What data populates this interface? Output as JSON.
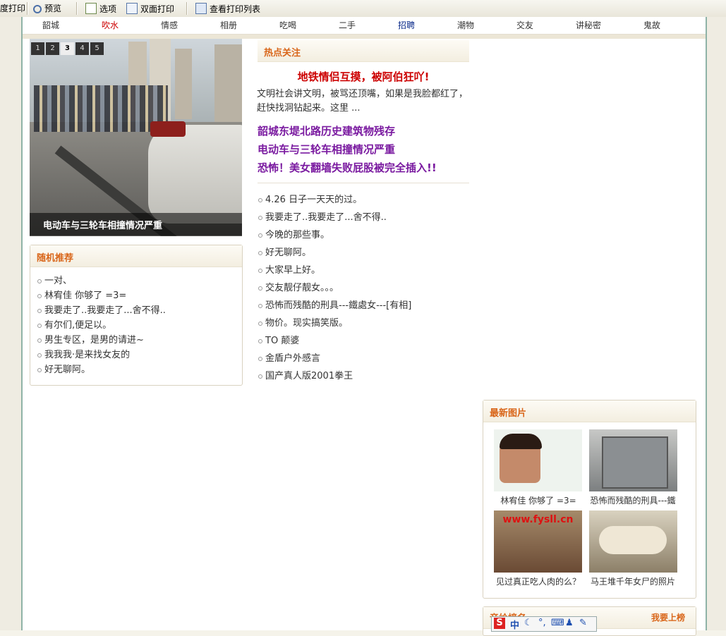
{
  "toolbar": {
    "print": "度打印",
    "preview": "预览",
    "options": "选项",
    "duplex": "双面打印",
    "print_list": "查看打印列表"
  },
  "nav": [
    "韶城",
    "吹水",
    "情感",
    "相册",
    "吃喝",
    "二手",
    "招聘",
    "潮物",
    "交友",
    "讲秘密",
    "鬼故"
  ],
  "slideshow": {
    "numbers": [
      "1",
      "2",
      "3",
      "4",
      "5"
    ],
    "active": "3",
    "caption": "电动车与三轮车相撞情况严重"
  },
  "random": {
    "title": "随机推荐",
    "items": [
      "一对、",
      "林宥佳 你够了 =3=",
      "我要走了..我要走了...舍不得..",
      "有尔们,便足以。",
      "男生专区，是男的请进~",
      "我我我·是来找女友的",
      "好无聊阿。"
    ]
  },
  "hot": {
    "title": "热点关注",
    "headline": "地铁情侣互摸，被阿伯狂吖!",
    "summary": "文明社会讲文明，被骂还顶嘴，如果是我脸都红了，赶快找洞钻起来。这里 ...",
    "links": [
      "韶城东堤北路历史建筑物残存",
      "电动车与三轮车相撞情况严重",
      "恐怖！美女翻墙失败屁股被完全插入!!"
    ],
    "list": [
      "4.26 日子一天天的过。",
      "我要走了..我要走了...舍不得..",
      "今晚的那些事。",
      "好无聊阿。",
      "大家早上好。",
      "交友靓仔靓女。。。",
      "恐怖而残酷的刑具---鐵處女---[有相]",
      "物价。现实搞笑版。",
      "TO 颠婆",
      "金盾户外感言",
      "国产真人版2001拳王"
    ]
  },
  "latest": {
    "title": "最新图片",
    "pics": [
      {
        "caption": "林宥佳 你够了 =3="
      },
      {
        "caption": "恐怖而残酷的刑具---鐵"
      },
      {
        "caption": "见过真正吃人肉的么？"
      },
      {
        "caption": "马王堆千年女尸的照片"
      }
    ]
  },
  "bottom": {
    "title": "音给榜名",
    "action": "我要上榜"
  },
  "ime": {
    "logo": "S",
    "lang": "中"
  },
  "colors": {
    "accent": "#d9661a",
    "link_purple": "#7a1aa0",
    "headline_red": "#cc0000"
  }
}
